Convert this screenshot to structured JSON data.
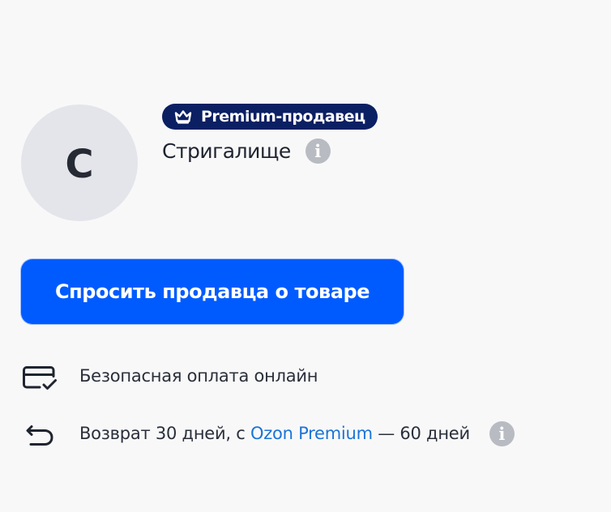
{
  "seller": {
    "avatar_letter": "C",
    "badge": "Premium-продавец",
    "name": "Стригалище"
  },
  "actions": {
    "ask_seller": "Спросить продавца о товаре"
  },
  "benefits": {
    "payment": "Безопасная оплата онлайн",
    "return_prefix": "Возврат 30 дней, с ",
    "return_link": "Ozon Premium",
    "return_suffix": " — 60 дней"
  },
  "icons": {
    "badge": "crown-icon",
    "seller_info": "info-icon",
    "payment": "card-check-icon",
    "return": "return-arrow-icon",
    "return_info": "info-icon"
  },
  "colors": {
    "background": "#f8f8f9",
    "avatar_background": "#e4e5ea",
    "badge_background": "#0b1f63",
    "button": "#005bff",
    "link": "#1b74d8",
    "info_icon": "#b8bbc1",
    "text": "#1f2430"
  }
}
